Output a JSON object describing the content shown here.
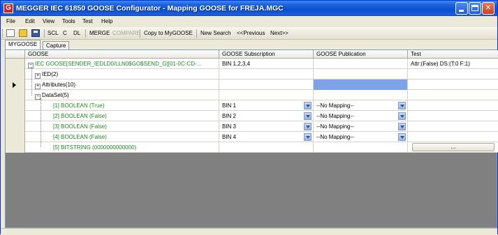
{
  "window": {
    "logo_letter": "G",
    "title": "MEGGER  IEC 61850 GOOSE Configurator - Mapping GOOSE for FREJA.MGC"
  },
  "menu": [
    "File",
    "Edit",
    "View",
    "Tools",
    "Test",
    "Help"
  ],
  "toolbar": {
    "scl": "SCL",
    "c": "C",
    "dl": "DL",
    "merge": "MERGE",
    "compare": "COMPARE",
    "copy": "Copy to MyGOOSE",
    "new_search": "New Search",
    "previous": "<<Previous",
    "next": "Next>>"
  },
  "tabs": [
    "MYGOOSE",
    "Capture"
  ],
  "grid": {
    "columns": [
      "GOOSE",
      "GOOSE Subscription",
      "GOOSE Publication",
      "Test"
    ],
    "rows": [
      {
        "goose": "IEC GOOSE[SENDER_IEDLD0/LLN0$GO$SEND_G][01-0C-CD-...",
        "subscription": "BIN 1,2,3,4",
        "publication": "",
        "test": "Attr:(False) DS:(T:0 F:1)"
      },
      {
        "goose": "IED(2)",
        "subscription": "",
        "publication": "",
        "test": ""
      },
      {
        "goose": "Attributes(10)",
        "subscription": "",
        "publication": "",
        "test": ""
      },
      {
        "goose": "DataSet(5)",
        "subscription": "",
        "publication": "",
        "test": ""
      },
      {
        "goose": "[1] BOOLEAN  (True)",
        "subscription": "BIN 1",
        "publication": "--No Mapping--",
        "test": ""
      },
      {
        "goose": "[2] BOOLEAN  (False)",
        "subscription": "BIN 2",
        "publication": "--No Mapping--",
        "test": ""
      },
      {
        "goose": "[3] BOOLEAN  (False)",
        "subscription": "BIN 3",
        "publication": "--No Mapping--",
        "test": ""
      },
      {
        "goose": "[4] BOOLEAN  (False)",
        "subscription": "BIN 4",
        "publication": "--No Mapping--",
        "test": ""
      },
      {
        "goose": "[5] BITSTRING  (0000000000000)",
        "subscription": "",
        "publication": "",
        "test": "..."
      }
    ]
  },
  "tree_glyphs": {
    "collapse": "−",
    "expand": "+"
  }
}
